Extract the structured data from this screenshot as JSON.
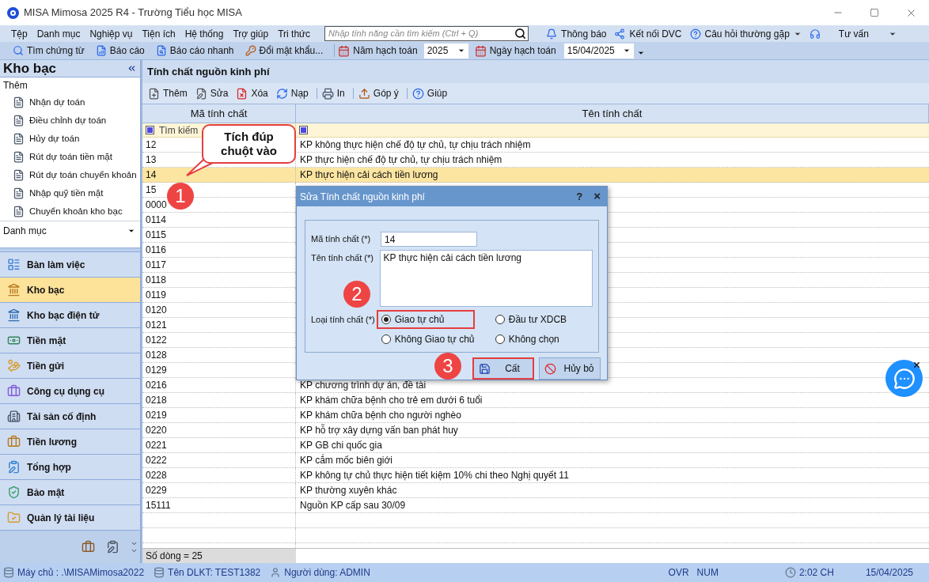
{
  "title_bar": {
    "title": "MISA Mimosa 2025 R4 - Trường Tiểu học MISA"
  },
  "menu_bar": {
    "items": [
      "Tệp",
      "Danh mục",
      "Nghiệp vụ",
      "Tiện ích",
      "Hệ thống",
      "Trợ giúp",
      "Tri thức"
    ],
    "search": {
      "placeholder": "Nhập tính năng cần tìm kiếm (Ctrl + Q)"
    },
    "right_items": [
      "Thông báo",
      "Kết nối DVC",
      "Câu hỏi thường gặp",
      "Tư vấn"
    ]
  },
  "toolbar": {
    "items": [
      "Tìm chứng từ",
      "Báo cáo",
      "Báo cáo nhanh",
      "Đổi mật khẩu..."
    ],
    "year_label": "Năm hạch toán",
    "year": "2025",
    "date_label": "Ngày hạch toán",
    "date": "15/04/2025"
  },
  "sidebar": {
    "title": "Kho bạc",
    "groups": [
      {
        "label": "Thêm",
        "items": [
          "Nhận dự toán",
          "Điều chỉnh dự toán",
          "Hủy dự toán",
          "Rút dự toán tiền mặt",
          "Rút dự toán chuyển khoản",
          "Nhập quỹ tiền mặt",
          "Chuyển khoản kho bạc"
        ]
      },
      {
        "label": "Danh mục"
      }
    ],
    "nav": [
      {
        "label": "Bàn làm việc",
        "selected": false
      },
      {
        "label": "Kho bạc",
        "selected": true
      },
      {
        "label": "Kho bạc điện tử",
        "selected": false
      },
      {
        "label": "Tiền mặt",
        "selected": false
      },
      {
        "label": "Tiền gửi",
        "selected": false
      },
      {
        "label": "Công cụ dụng cụ",
        "selected": false
      },
      {
        "label": "Tài sản cố định",
        "selected": false
      },
      {
        "label": "Tiền lương",
        "selected": false
      },
      {
        "label": "Tổng hợp",
        "selected": false
      },
      {
        "label": "Bảo mật",
        "selected": false
      },
      {
        "label": "Quản lý tài liệu",
        "selected": false
      }
    ]
  },
  "content": {
    "title": "Tính chất nguồn kinh phí",
    "toolbar": [
      "Thêm",
      "Sửa",
      "Xóa",
      "Nạp",
      "In",
      "Góp ý",
      "Giúp"
    ],
    "table": {
      "columns": [
        "Mã tính chất",
        "Tên tính chất"
      ],
      "filter_placeholder": "Tìm kiếm",
      "rows": [
        {
          "code": "12",
          "name": "KP không thực hiện chế độ tự chủ, tự chịu trách nhiệm",
          "selected": false
        },
        {
          "code": "13",
          "name": "KP thực hiện chế độ tự chủ, tự chịu trách nhiệm",
          "selected": false
        },
        {
          "code": "14",
          "name": "KP thực hiện cải cách tiền lương",
          "selected": true
        },
        {
          "code": "15",
          "selected": false
        },
        {
          "code": "0000",
          "selected": false
        },
        {
          "code": "0114",
          "selected": false
        },
        {
          "code": "0115",
          "selected": false
        },
        {
          "code": "0116",
          "selected": false
        },
        {
          "code": "0117",
          "selected": false
        },
        {
          "code": "0118",
          "selected": false
        },
        {
          "code": "0119",
          "selected": false
        },
        {
          "code": "0120",
          "selected": false
        },
        {
          "code": "0121",
          "selected": false
        },
        {
          "code": "0122",
          "selected": false
        },
        {
          "code": "0128",
          "selected": false
        },
        {
          "code": "0129",
          "selected": false
        },
        {
          "code": "0216",
          "name": "KP chương trình dự án, đề tài",
          "selected": false
        },
        {
          "code": "0218",
          "name": "KP khám chữa bệnh cho trẻ em dưới 6 tuổi",
          "selected": false
        },
        {
          "code": "0219",
          "name": "KP khám chữa bệnh cho người nghèo",
          "selected": false
        },
        {
          "code": "0220",
          "name": "KP hỗ trợ xây dựng vấn ban phát huy",
          "selected": false
        },
        {
          "code": "0221",
          "name": "KP GB chi quốc gia",
          "selected": false
        },
        {
          "code": "0222",
          "name": "KP cắm mốc biên giới",
          "selected": false
        },
        {
          "code": "0228",
          "name": "KP không tự chủ thực hiện tiết kiệm 10% chi theo Nghị quyết 11",
          "selected": false
        },
        {
          "code": "0229",
          "name": "KP thường xuyên khác",
          "selected": false
        },
        {
          "code": "15111",
          "name": "Nguồn KP cấp sau 30/09",
          "selected": false
        }
      ],
      "footer": "Số dòng = 25"
    }
  },
  "dialog": {
    "title": "Sửa Tính chất nguồn kinh phí",
    "help": "?",
    "close": "×",
    "code_label": "Mã tính chất (*)",
    "code_value": "14",
    "name_label": "Tên tính chất (*)",
    "name_value": "KP thực hiện cải cách tiền lương",
    "type_label": "Loại tính chất (*)",
    "options": [
      {
        "label": "Giao tự chủ",
        "selected": true,
        "highlighted": true
      },
      {
        "label": "Đầu tư XDCB",
        "selected": false,
        "highlighted": false
      },
      {
        "label": "Không Giao tự chủ",
        "selected": false,
        "highlighted": false
      },
      {
        "label": "Không chọn",
        "selected": false,
        "highlighted": false
      }
    ],
    "buttons": [
      {
        "label": "Cất",
        "highlighted": true
      },
      {
        "label": "Hủy bỏ",
        "highlighted": false
      }
    ]
  },
  "annotations": {
    "callout": "Tích đúp chuột vào",
    "steps": [
      "1",
      "2",
      "3"
    ]
  },
  "status_bar": {
    "server": "Máy chủ : .\\MISAMimosa2022",
    "database": "Tên DLKT: TEST1382",
    "user": "Người dùng: ADMIN",
    "ovr": "OVR",
    "num": "NUM",
    "time": "2:02 CH",
    "date": "15/04/2025"
  }
}
